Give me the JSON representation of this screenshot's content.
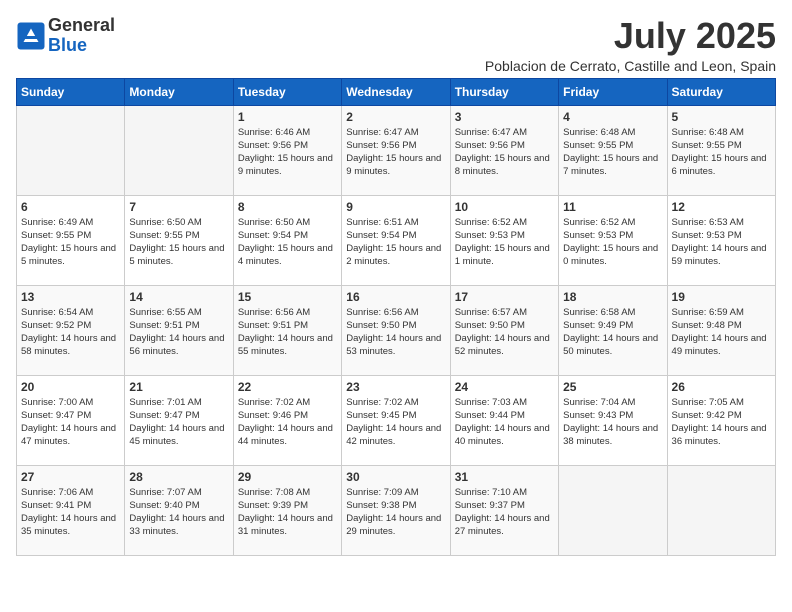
{
  "header": {
    "logo_line1": "General",
    "logo_line2": "Blue",
    "month_year": "July 2025",
    "location": "Poblacion de Cerrato, Castille and Leon, Spain"
  },
  "days_of_week": [
    "Sunday",
    "Monday",
    "Tuesday",
    "Wednesday",
    "Thursday",
    "Friday",
    "Saturday"
  ],
  "weeks": [
    [
      {
        "day": "",
        "info": ""
      },
      {
        "day": "",
        "info": ""
      },
      {
        "day": "1",
        "info": "Sunrise: 6:46 AM\nSunset: 9:56 PM\nDaylight: 15 hours and 9 minutes."
      },
      {
        "day": "2",
        "info": "Sunrise: 6:47 AM\nSunset: 9:56 PM\nDaylight: 15 hours and 9 minutes."
      },
      {
        "day": "3",
        "info": "Sunrise: 6:47 AM\nSunset: 9:56 PM\nDaylight: 15 hours and 8 minutes."
      },
      {
        "day": "4",
        "info": "Sunrise: 6:48 AM\nSunset: 9:55 PM\nDaylight: 15 hours and 7 minutes."
      },
      {
        "day": "5",
        "info": "Sunrise: 6:48 AM\nSunset: 9:55 PM\nDaylight: 15 hours and 6 minutes."
      }
    ],
    [
      {
        "day": "6",
        "info": "Sunrise: 6:49 AM\nSunset: 9:55 PM\nDaylight: 15 hours and 5 minutes."
      },
      {
        "day": "7",
        "info": "Sunrise: 6:50 AM\nSunset: 9:55 PM\nDaylight: 15 hours and 5 minutes."
      },
      {
        "day": "8",
        "info": "Sunrise: 6:50 AM\nSunset: 9:54 PM\nDaylight: 15 hours and 4 minutes."
      },
      {
        "day": "9",
        "info": "Sunrise: 6:51 AM\nSunset: 9:54 PM\nDaylight: 15 hours and 2 minutes."
      },
      {
        "day": "10",
        "info": "Sunrise: 6:52 AM\nSunset: 9:53 PM\nDaylight: 15 hours and 1 minute."
      },
      {
        "day": "11",
        "info": "Sunrise: 6:52 AM\nSunset: 9:53 PM\nDaylight: 15 hours and 0 minutes."
      },
      {
        "day": "12",
        "info": "Sunrise: 6:53 AM\nSunset: 9:53 PM\nDaylight: 14 hours and 59 minutes."
      }
    ],
    [
      {
        "day": "13",
        "info": "Sunrise: 6:54 AM\nSunset: 9:52 PM\nDaylight: 14 hours and 58 minutes."
      },
      {
        "day": "14",
        "info": "Sunrise: 6:55 AM\nSunset: 9:51 PM\nDaylight: 14 hours and 56 minutes."
      },
      {
        "day": "15",
        "info": "Sunrise: 6:56 AM\nSunset: 9:51 PM\nDaylight: 14 hours and 55 minutes."
      },
      {
        "day": "16",
        "info": "Sunrise: 6:56 AM\nSunset: 9:50 PM\nDaylight: 14 hours and 53 minutes."
      },
      {
        "day": "17",
        "info": "Sunrise: 6:57 AM\nSunset: 9:50 PM\nDaylight: 14 hours and 52 minutes."
      },
      {
        "day": "18",
        "info": "Sunrise: 6:58 AM\nSunset: 9:49 PM\nDaylight: 14 hours and 50 minutes."
      },
      {
        "day": "19",
        "info": "Sunrise: 6:59 AM\nSunset: 9:48 PM\nDaylight: 14 hours and 49 minutes."
      }
    ],
    [
      {
        "day": "20",
        "info": "Sunrise: 7:00 AM\nSunset: 9:47 PM\nDaylight: 14 hours and 47 minutes."
      },
      {
        "day": "21",
        "info": "Sunrise: 7:01 AM\nSunset: 9:47 PM\nDaylight: 14 hours and 45 minutes."
      },
      {
        "day": "22",
        "info": "Sunrise: 7:02 AM\nSunset: 9:46 PM\nDaylight: 14 hours and 44 minutes."
      },
      {
        "day": "23",
        "info": "Sunrise: 7:02 AM\nSunset: 9:45 PM\nDaylight: 14 hours and 42 minutes."
      },
      {
        "day": "24",
        "info": "Sunrise: 7:03 AM\nSunset: 9:44 PM\nDaylight: 14 hours and 40 minutes."
      },
      {
        "day": "25",
        "info": "Sunrise: 7:04 AM\nSunset: 9:43 PM\nDaylight: 14 hours and 38 minutes."
      },
      {
        "day": "26",
        "info": "Sunrise: 7:05 AM\nSunset: 9:42 PM\nDaylight: 14 hours and 36 minutes."
      }
    ],
    [
      {
        "day": "27",
        "info": "Sunrise: 7:06 AM\nSunset: 9:41 PM\nDaylight: 14 hours and 35 minutes."
      },
      {
        "day": "28",
        "info": "Sunrise: 7:07 AM\nSunset: 9:40 PM\nDaylight: 14 hours and 33 minutes."
      },
      {
        "day": "29",
        "info": "Sunrise: 7:08 AM\nSunset: 9:39 PM\nDaylight: 14 hours and 31 minutes."
      },
      {
        "day": "30",
        "info": "Sunrise: 7:09 AM\nSunset: 9:38 PM\nDaylight: 14 hours and 29 minutes."
      },
      {
        "day": "31",
        "info": "Sunrise: 7:10 AM\nSunset: 9:37 PM\nDaylight: 14 hours and 27 minutes."
      },
      {
        "day": "",
        "info": ""
      },
      {
        "day": "",
        "info": ""
      }
    ]
  ]
}
